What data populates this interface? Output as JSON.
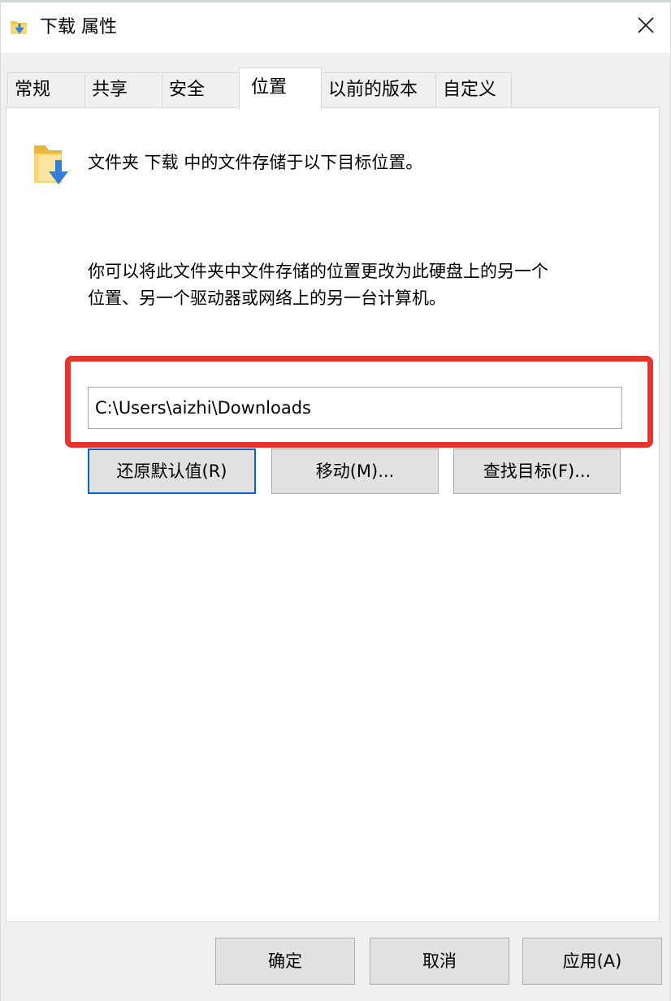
{
  "window": {
    "title": "下载 属性",
    "icon": "folder-download-icon",
    "close_icon": "close-icon"
  },
  "tabs": [
    {
      "label": "常规"
    },
    {
      "label": "共享"
    },
    {
      "label": "安全"
    },
    {
      "label": "位置",
      "active": true
    },
    {
      "label": "以前的版本"
    },
    {
      "label": "自定义"
    }
  ],
  "location": {
    "heading": "文件夹 下载 中的文件存储于以下目标位置。",
    "description_line1": "你可以将此文件夹中文件存储的位置更改为此硬盘上的另一个",
    "description_line2": "位置、另一个驱动器或网络上的另一台计算机。",
    "path_value": "C:\\Users\\aizhi\\Downloads",
    "buttons": {
      "restore_default": "还原默认值(R)",
      "move": "移动(M)...",
      "find_target": "查找目标(F)..."
    }
  },
  "footer": {
    "ok": "确定",
    "cancel": "取消",
    "apply": "应用(A)"
  },
  "colors": {
    "highlight": "#e8332c",
    "focus": "#0a64c8",
    "folder_yellow": "#f2c94c",
    "arrow_blue": "#2f80d6"
  }
}
